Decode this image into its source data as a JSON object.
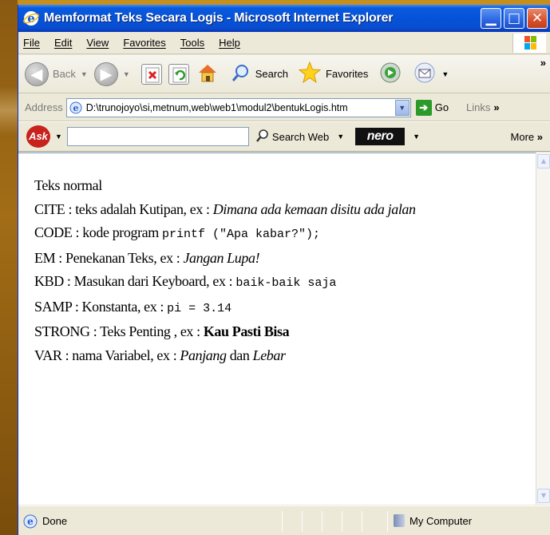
{
  "window": {
    "title": "Memformat Teks Secara Logis - Microsoft Internet Explorer",
    "controls": {
      "minimize": "_",
      "maximize": "□",
      "close": "X"
    }
  },
  "menu": {
    "items": [
      "File",
      "Edit",
      "View",
      "Favorites",
      "Tools",
      "Help"
    ]
  },
  "toolbar": {
    "back_label": "Back",
    "search_label": "Search",
    "favorites_label": "Favorites"
  },
  "address": {
    "label": "Address",
    "value": "D:\\trunojoyo\\si,metnum,web\\web1\\modul2\\bentukLogis.htm",
    "go_label": "Go",
    "links_label": "Links"
  },
  "askbar": {
    "logo": "Ask",
    "search_web_label": "Search Web",
    "nero_logo": "nero",
    "more_label": "More"
  },
  "document": {
    "lines": [
      {
        "text": "Teks normal"
      },
      {
        "prefix": "CITE : teks adalah Kutipan, ex : ",
        "example": "Dimana ada kemaan disitu ada jalan"
      },
      {
        "prefix": "CODE : kode program ",
        "example": "printf (\"Apa kabar?\");"
      },
      {
        "prefix": "EM : Penekanan Teks, ex : ",
        "example": "Jangan Lupa!"
      },
      {
        "prefix": "KBD : Masukan dari Keyboard, ex : ",
        "example": "baik-baik saja"
      },
      {
        "prefix": "SAMP : Konstanta, ex : ",
        "example": "pi = 3.14"
      },
      {
        "prefix": "STRONG : Teks Penting , ex : ",
        "example": "Kau Pasti Bisa"
      },
      {
        "prefix": "VAR : nama Variabel, ex : ",
        "example": "Panjang",
        "middle": " dan ",
        "example2": "Lebar"
      }
    ]
  },
  "status": {
    "text": "Done",
    "zone": "My Computer"
  }
}
